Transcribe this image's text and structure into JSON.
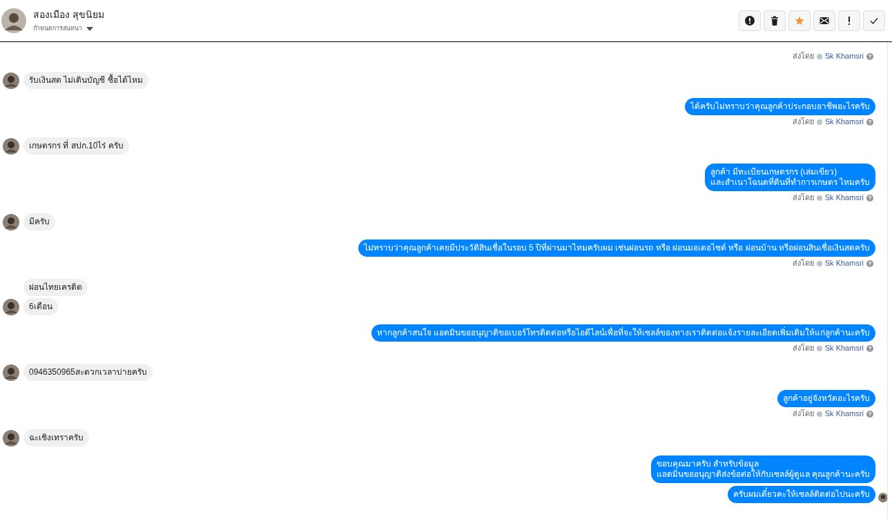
{
  "header": {
    "name": "สองเมือง สุขนิยม",
    "subtitle": "กำหนดการสนทนา",
    "actions": [
      {
        "kind": "alert"
      },
      {
        "kind": "trash"
      },
      {
        "kind": "star"
      },
      {
        "kind": "mail"
      },
      {
        "kind": "exclaim"
      },
      {
        "kind": "check"
      }
    ]
  },
  "messages": [
    {
      "kind": "sent_by",
      "label": "ส่งโดย",
      "sender": "Sk Khamsri"
    },
    {
      "kind": "incoming",
      "text": "รับเงินสด ไม่เดินบัญชี ซื้อได้ไหม"
    },
    {
      "kind": "outgoing",
      "lines": [
        "ได้ครับไม่ทราบว่าคุณลูกค้าประกอบอาชีพอะไรครับ"
      ]
    },
    {
      "kind": "sent_by",
      "label": "ส่งโดย",
      "sender": "Sk Khamsri"
    },
    {
      "kind": "incoming",
      "text": "เกษตรกร ที่ สปก.10ไร่ ครับ"
    },
    {
      "kind": "outgoing",
      "lines": [
        "ลูกค้า มีทะเบียนเกษตรกร (เล่มเขียว)",
        "และสำเนาโฉนดที่ดินที่ทำการเกษตร ไหมครับ"
      ]
    },
    {
      "kind": "sent_by",
      "label": "ส่งโดย",
      "sender": "Sk Khamsri"
    },
    {
      "kind": "incoming",
      "text": "มีครับ"
    },
    {
      "kind": "outgoing",
      "lines": [
        "ไม่ทราบว่าคุณลูกค้าเคยมีประวัติสินเชื่อในรอบ 5 ปีที่ผ่านมาไหมครับผม เช่นผ่อนรถ หรือ ผ่อนมอเตอไซด์ หรือ ผ่อนบ้าน หรือผ่อนสินเชื่อเงินสดครับ"
      ]
    },
    {
      "kind": "sent_by",
      "label": "ส่งโดย",
      "sender": "Sk Khamsri"
    },
    {
      "kind": "incoming",
      "text": "ผ่อนไทยเครดิต"
    },
    {
      "kind": "incoming",
      "text": "6เดือน"
    },
    {
      "kind": "outgoing",
      "lines": [
        "หากลูกค้าสนใจ แอดมินขออนุญาติขอเบอร์โทรติดต่อหรือไอดีไลน์เพื่อที่จะให้เซลล์ของทางเราติดต่อแจ้งรายละเอียดเพิ่มเติมให้แก่ลูกค้านะครับ"
      ]
    },
    {
      "kind": "sent_by",
      "label": "ส่งโดย",
      "sender": "Sk Khamsri"
    },
    {
      "kind": "incoming",
      "text": "0946350965สะดวกเวลาบ่ายครับ"
    },
    {
      "kind": "outgoing",
      "lines": [
        "ลูกค้าอยู่จังหวัดอะไรครับ"
      ]
    },
    {
      "kind": "sent_by",
      "label": "ส่งโดย",
      "sender": "Sk Khamsri"
    },
    {
      "kind": "incoming",
      "text": "ฉะเชิงเทราครับ"
    },
    {
      "kind": "outgoing",
      "lines": [
        "ขอบคุณมาครับ สำหรับข้อมูล",
        "แอดมินขออนุญาติส่งข้อต่อให้กับเซลล์ผู้ดูแล คุณลูกค้านะครับ"
      ]
    },
    {
      "kind": "outgoing",
      "lines": [
        "ครับผมเดี๋ยวคะให้เซลล์ติดต่อไปนะครับ"
      ]
    }
  ]
}
